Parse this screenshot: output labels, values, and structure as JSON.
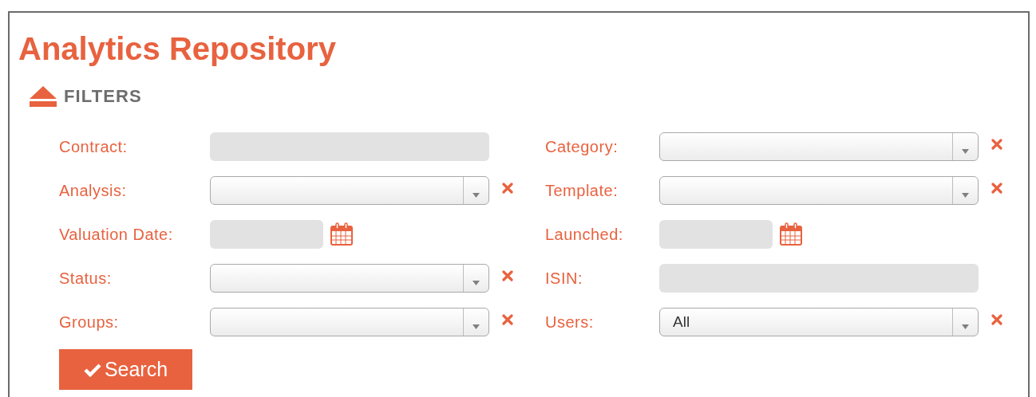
{
  "title": "Analytics Repository",
  "filters": {
    "label": "FILTERS",
    "expanded": true,
    "left": [
      {
        "label": "Contract:",
        "kind": "text"
      },
      {
        "label": "Analysis:",
        "kind": "select"
      },
      {
        "label": "Valuation Date:",
        "kind": "date"
      },
      {
        "label": "Status:",
        "kind": "select"
      },
      {
        "label": "Groups:",
        "kind": "select"
      }
    ],
    "right": [
      {
        "label": "Category:",
        "kind": "select"
      },
      {
        "label": "Template:",
        "kind": "select"
      },
      {
        "label": "Launched:",
        "kind": "date"
      },
      {
        "label": "ISIN:",
        "kind": "text"
      },
      {
        "label": "Users:",
        "kind": "select",
        "value": "All"
      }
    ]
  },
  "search_button": "Search"
}
